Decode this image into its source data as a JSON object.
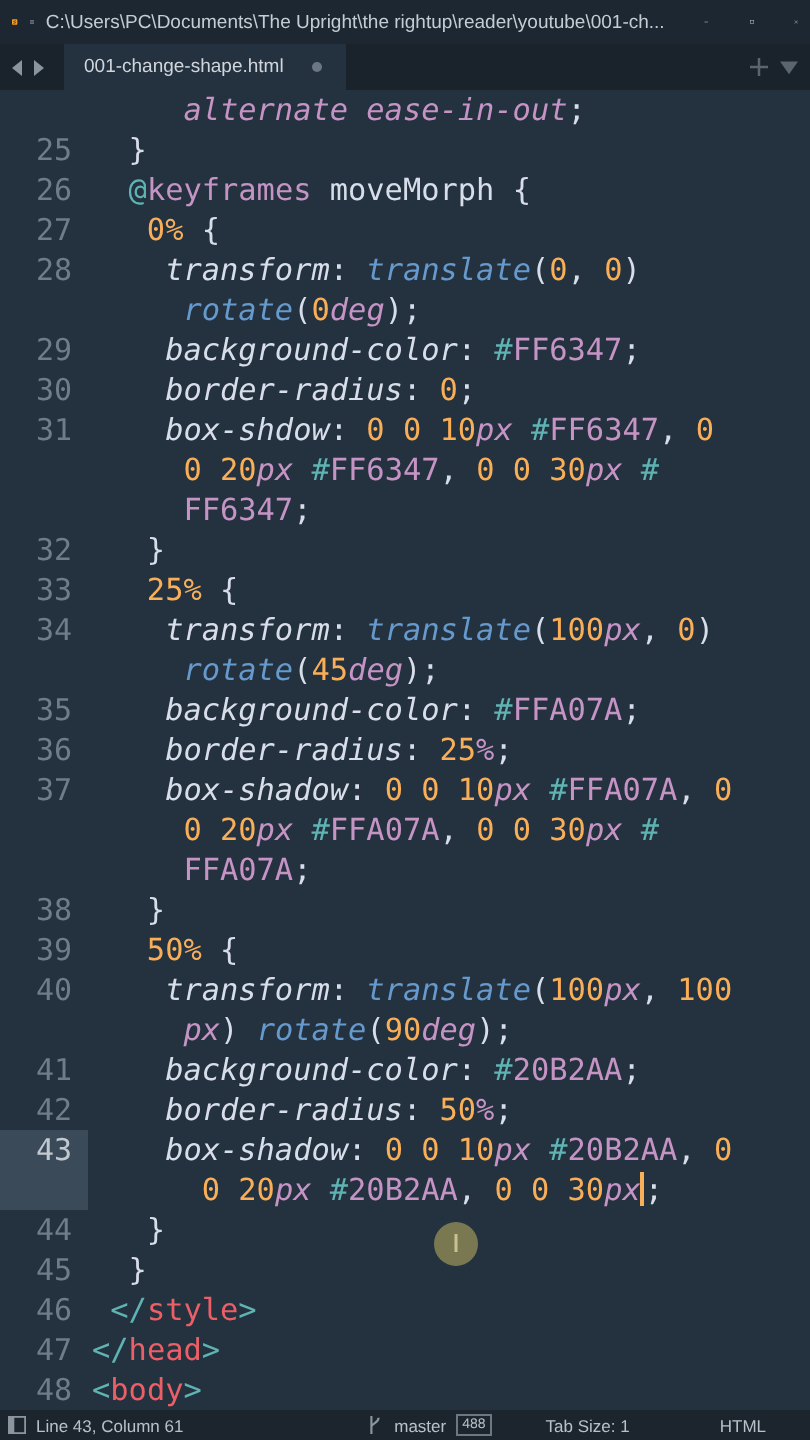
{
  "window": {
    "title": "C:\\Users\\PC\\Documents\\The Upright\\the rightup\\reader\\youtube\\001-ch..."
  },
  "tabs": [
    {
      "label": "001-change-shape.html",
      "selected": true,
      "modified": true
    }
  ],
  "editor": {
    "lines": [
      {
        "rows": [
          {
            "tokens": [
              {
                "kind": "val",
                "text": "     alternate ease-in-out"
              },
              {
                "kind": "p",
                "text": ";"
              }
            ]
          }
        ]
      },
      {
        "number": "25",
        "current": false,
        "rows": [
          {
            "tokens": [
              {
                "kind": "p",
                "text": "  }"
              }
            ]
          }
        ]
      },
      {
        "number": "26",
        "current": false,
        "rows": [
          {
            "tokens": [
              {
                "kind": "at",
                "text": "  @"
              },
              {
                "kind": "kw",
                "text": "keyframes"
              },
              {
                "kind": "p",
                "text": " moveMorph {"
              }
            ]
          }
        ]
      },
      {
        "number": "27",
        "current": false,
        "rows": [
          {
            "tokens": [
              {
                "kind": "num",
                "text": "   0%"
              },
              {
                "kind": "p",
                "text": " {"
              }
            ]
          }
        ]
      },
      {
        "number": "28",
        "current": false,
        "rows": [
          {
            "tokens": [
              {
                "kind": "prop",
                "text": "    transform"
              },
              {
                "kind": "p",
                "text": ": "
              },
              {
                "kind": "fn",
                "text": "translate"
              },
              {
                "kind": "p",
                "text": "("
              },
              {
                "kind": "num",
                "text": "0"
              },
              {
                "kind": "p",
                "text": ", "
              },
              {
                "kind": "num",
                "text": "0"
              },
              {
                "kind": "p",
                "text": ")"
              }
            ]
          },
          {
            "tokens": [
              {
                "kind": "fn",
                "text": "     rotate"
              },
              {
                "kind": "p",
                "text": "("
              },
              {
                "kind": "num",
                "text": "0"
              },
              {
                "kind": "unit",
                "text": "deg"
              },
              {
                "kind": "p",
                "text": ");"
              }
            ]
          }
        ]
      },
      {
        "number": "29",
        "current": false,
        "rows": [
          {
            "tokens": [
              {
                "kind": "prop",
                "text": "    background-color"
              },
              {
                "kind": "p",
                "text": ": "
              },
              {
                "kind": "hash",
                "text": "#"
              },
              {
                "kind": "hex",
                "text": "FF6347"
              },
              {
                "kind": "p",
                "text": ";"
              }
            ]
          }
        ]
      },
      {
        "number": "30",
        "current": false,
        "rows": [
          {
            "tokens": [
              {
                "kind": "prop",
                "text": "    border-radius"
              },
              {
                "kind": "p",
                "text": ": "
              },
              {
                "kind": "num",
                "text": "0"
              },
              {
                "kind": "p",
                "text": ";"
              }
            ]
          }
        ]
      },
      {
        "number": "31",
        "current": false,
        "rows": [
          {
            "tokens": [
              {
                "kind": "prop",
                "text": "    box-shdow"
              },
              {
                "kind": "p",
                "text": ": "
              },
              {
                "kind": "num",
                "text": "0 0 10"
              },
              {
                "kind": "unit",
                "text": "px"
              },
              {
                "kind": "hash",
                "text": " #"
              },
              {
                "kind": "hex",
                "text": "FF6347"
              },
              {
                "kind": "p",
                "text": ", "
              },
              {
                "kind": "num",
                "text": "0"
              }
            ]
          },
          {
            "tokens": [
              {
                "kind": "num",
                "text": "     0 20"
              },
              {
                "kind": "unit",
                "text": "px"
              },
              {
                "kind": "hash",
                "text": " #"
              },
              {
                "kind": "hex",
                "text": "FF6347"
              },
              {
                "kind": "p",
                "text": ", "
              },
              {
                "kind": "num",
                "text": "0 0 30"
              },
              {
                "kind": "unit",
                "text": "px"
              },
              {
                "kind": "hash",
                "text": " #"
              }
            ]
          },
          {
            "tokens": [
              {
                "kind": "hex",
                "text": "     FF6347"
              },
              {
                "kind": "p",
                "text": ";"
              }
            ]
          }
        ]
      },
      {
        "number": "32",
        "current": false,
        "rows": [
          {
            "tokens": [
              {
                "kind": "p",
                "text": "   }"
              }
            ]
          }
        ]
      },
      {
        "number": "33",
        "current": false,
        "rows": [
          {
            "tokens": [
              {
                "kind": "num",
                "text": "   25%"
              },
              {
                "kind": "p",
                "text": " {"
              }
            ]
          }
        ]
      },
      {
        "number": "34",
        "current": false,
        "rows": [
          {
            "tokens": [
              {
                "kind": "prop",
                "text": "    transform"
              },
              {
                "kind": "p",
                "text": ": "
              },
              {
                "kind": "fn",
                "text": "translate"
              },
              {
                "kind": "p",
                "text": "("
              },
              {
                "kind": "num",
                "text": "100"
              },
              {
                "kind": "unit",
                "text": "px"
              },
              {
                "kind": "p",
                "text": ", "
              },
              {
                "kind": "num",
                "text": "0"
              },
              {
                "kind": "p",
                "text": ")"
              }
            ]
          },
          {
            "tokens": [
              {
                "kind": "fn",
                "text": "     rotate"
              },
              {
                "kind": "p",
                "text": "("
              },
              {
                "kind": "num",
                "text": "45"
              },
              {
                "kind": "unit",
                "text": "deg"
              },
              {
                "kind": "p",
                "text": ");"
              }
            ]
          }
        ]
      },
      {
        "number": "35",
        "current": false,
        "rows": [
          {
            "tokens": [
              {
                "kind": "prop",
                "text": "    background-color"
              },
              {
                "kind": "p",
                "text": ": "
              },
              {
                "kind": "hash",
                "text": "#"
              },
              {
                "kind": "hex",
                "text": "FFA07A"
              },
              {
                "kind": "p",
                "text": ";"
              }
            ]
          }
        ]
      },
      {
        "number": "36",
        "current": false,
        "rows": [
          {
            "tokens": [
              {
                "kind": "prop",
                "text": "    border-radius"
              },
              {
                "kind": "p",
                "text": ": "
              },
              {
                "kind": "num",
                "text": "25"
              },
              {
                "kind": "unit",
                "text": "%"
              },
              {
                "kind": "p",
                "text": ";"
              }
            ]
          }
        ]
      },
      {
        "number": "37",
        "current": false,
        "rows": [
          {
            "tokens": [
              {
                "kind": "prop",
                "text": "    box-shadow"
              },
              {
                "kind": "p",
                "text": ": "
              },
              {
                "kind": "num",
                "text": "0 0 10"
              },
              {
                "kind": "unit",
                "text": "px"
              },
              {
                "kind": "hash",
                "text": " #"
              },
              {
                "kind": "hex",
                "text": "FFA07A"
              },
              {
                "kind": "p",
                "text": ", "
              },
              {
                "kind": "num",
                "text": "0"
              }
            ]
          },
          {
            "tokens": [
              {
                "kind": "num",
                "text": "     0 20"
              },
              {
                "kind": "unit",
                "text": "px"
              },
              {
                "kind": "hash",
                "text": " #"
              },
              {
                "kind": "hex",
                "text": "FFA07A"
              },
              {
                "kind": "p",
                "text": ", "
              },
              {
                "kind": "num",
                "text": "0 0 30"
              },
              {
                "kind": "unit",
                "text": "px"
              },
              {
                "kind": "hash",
                "text": " #"
              }
            ]
          },
          {
            "tokens": [
              {
                "kind": "hex",
                "text": "     FFA07A"
              },
              {
                "kind": "p",
                "text": ";"
              }
            ]
          }
        ]
      },
      {
        "number": "38",
        "current": false,
        "rows": [
          {
            "tokens": [
              {
                "kind": "p",
                "text": "   }"
              }
            ]
          }
        ]
      },
      {
        "number": "39",
        "current": false,
        "rows": [
          {
            "tokens": [
              {
                "kind": "num",
                "text": "   50%"
              },
              {
                "kind": "p",
                "text": " {"
              }
            ]
          }
        ]
      },
      {
        "number": "40",
        "current": false,
        "rows": [
          {
            "tokens": [
              {
                "kind": "prop",
                "text": "    transform"
              },
              {
                "kind": "p",
                "text": ": "
              },
              {
                "kind": "fn",
                "text": "translate"
              },
              {
                "kind": "p",
                "text": "("
              },
              {
                "kind": "num",
                "text": "100"
              },
              {
                "kind": "unit",
                "text": "px"
              },
              {
                "kind": "p",
                "text": ", "
              },
              {
                "kind": "num",
                "text": "100"
              }
            ]
          },
          {
            "tokens": [
              {
                "kind": "unit",
                "text": "     px"
              },
              {
                "kind": "p",
                "text": ") "
              },
              {
                "kind": "fn",
                "text": "rotate"
              },
              {
                "kind": "p",
                "text": "("
              },
              {
                "kind": "num",
                "text": "90"
              },
              {
                "kind": "unit",
                "text": "deg"
              },
              {
                "kind": "p",
                "text": ");"
              }
            ]
          }
        ]
      },
      {
        "number": "41",
        "current": false,
        "rows": [
          {
            "tokens": [
              {
                "kind": "prop",
                "text": "    background-color"
              },
              {
                "kind": "p",
                "text": ": "
              },
              {
                "kind": "hash",
                "text": "#"
              },
              {
                "kind": "hex",
                "text": "20B2AA"
              },
              {
                "kind": "p",
                "text": ";"
              }
            ]
          }
        ]
      },
      {
        "number": "42",
        "current": false,
        "rows": [
          {
            "tokens": [
              {
                "kind": "prop",
                "text": "    border-radius"
              },
              {
                "kind": "p",
                "text": ": "
              },
              {
                "kind": "num",
                "text": "50"
              },
              {
                "kind": "unit",
                "text": "%"
              },
              {
                "kind": "p",
                "text": ";"
              }
            ]
          }
        ]
      },
      {
        "number": "43",
        "current": true,
        "rows": [
          {
            "tokens": [
              {
                "kind": "prop",
                "text": "    box-shadow"
              },
              {
                "kind": "p",
                "text": ": "
              },
              {
                "kind": "num",
                "text": "0 0 10"
              },
              {
                "kind": "unit",
                "text": "px"
              },
              {
                "kind": "hash",
                "text": " #"
              },
              {
                "kind": "hex",
                "text": "20B2AA"
              },
              {
                "kind": "p",
                "text": ", "
              },
              {
                "kind": "num",
                "text": "0"
              }
            ]
          },
          {
            "tokens": [
              {
                "kind": "num",
                "text": "      0 20"
              },
              {
                "kind": "unit",
                "text": "px"
              },
              {
                "kind": "hash",
                "text": " #"
              },
              {
                "kind": "hex",
                "text": "20B2AA"
              },
              {
                "kind": "p",
                "text": ", "
              },
              {
                "kind": "num",
                "text": "0 0 30"
              },
              {
                "kind": "unit",
                "text": "px",
                "caret": true
              },
              {
                "kind": "p",
                "text": ";"
              }
            ]
          }
        ]
      },
      {
        "number": "44",
        "current": false,
        "rows": [
          {
            "tokens": [
              {
                "kind": "p",
                "text": "   }"
              }
            ]
          }
        ]
      },
      {
        "number": "45",
        "current": false,
        "rows": [
          {
            "tokens": [
              {
                "kind": "p",
                "text": "  }"
              }
            ]
          }
        ]
      },
      {
        "number": "46",
        "current": false,
        "rows": [
          {
            "tokens": [
              {
                "kind": "br",
                "text": " </"
              },
              {
                "kind": "tag",
                "text": "style"
              },
              {
                "kind": "br",
                "text": ">"
              }
            ]
          }
        ]
      },
      {
        "number": "47",
        "current": false,
        "rows": [
          {
            "tokens": [
              {
                "kind": "br",
                "text": "</"
              },
              {
                "kind": "tag",
                "text": "head"
              },
              {
                "kind": "br",
                "text": ">"
              }
            ]
          }
        ]
      },
      {
        "number": "48",
        "current": false,
        "rows": [
          {
            "tokens": [
              {
                "kind": "br",
                "text": "<"
              },
              {
                "kind": "tag",
                "text": "body"
              },
              {
                "kind": "br",
                "text": ">"
              }
            ]
          }
        ]
      }
    ]
  },
  "status_bar": {
    "position": "Line 43, Column 61",
    "branch": "master",
    "changes": "488",
    "tab_size": "Tab Size: 1",
    "syntax": "HTML"
  }
}
